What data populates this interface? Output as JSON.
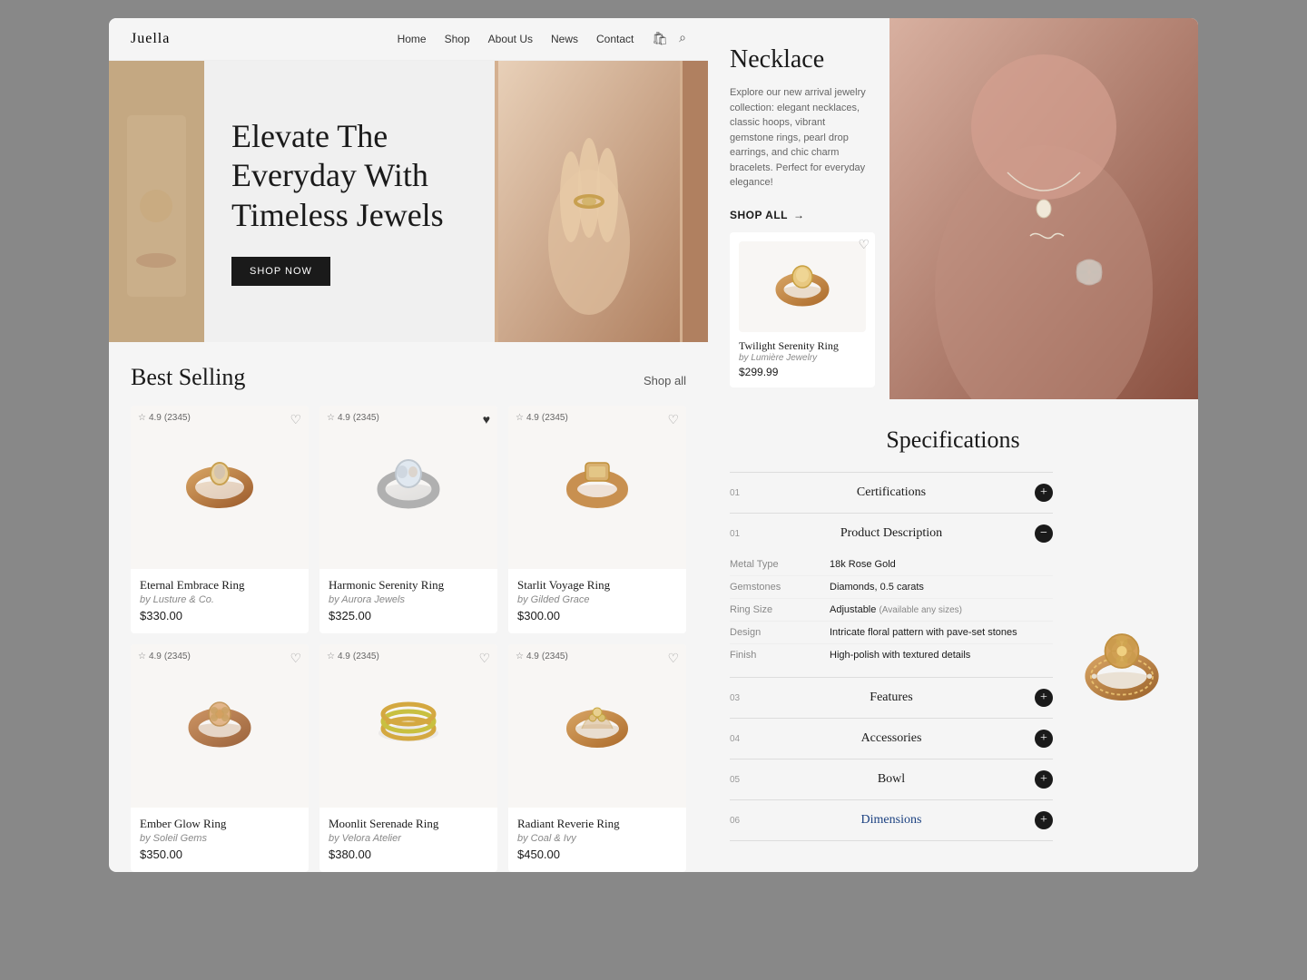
{
  "brand": "Juella",
  "nav": {
    "links": [
      "Home",
      "Shop",
      "About Us",
      "News",
      "Contact"
    ]
  },
  "hero": {
    "title": "Elevate The Everyday With Timeless Jewels",
    "cta": "SHOP NOW"
  },
  "best_selling": {
    "title": "Best Selling",
    "shop_all": "Shop all",
    "products": [
      {
        "name": "Eternal Embrace Ring",
        "brand": "by Lusture & Co.",
        "price": "$330.00",
        "rating": "4.9",
        "review_count": "(2345)",
        "favorited": false,
        "row": 1
      },
      {
        "name": "Harmonic Serenity Ring",
        "brand": "by Aurora Jewels",
        "price": "$325.00",
        "rating": "4.9",
        "review_count": "(2345)",
        "favorited": true,
        "row": 1
      },
      {
        "name": "Starlit Voyage Ring",
        "brand": "by Gilded Grace",
        "price": "$300.00",
        "rating": "4.9",
        "review_count": "(2345)",
        "favorited": false,
        "row": 1
      },
      {
        "name": "Ember Glow Ring",
        "brand": "by Soleil Gems",
        "price": "$350.00",
        "rating": "4.9",
        "review_count": "(2345)",
        "favorited": false,
        "row": 2
      },
      {
        "name": "Moonlit Serenade Ring",
        "brand": "by Velora Atelier",
        "price": "$380.00",
        "rating": "4.9",
        "review_count": "(2345)",
        "favorited": false,
        "row": 2
      },
      {
        "name": "Radiant Reverie Ring",
        "brand": "by Coal & Ivy",
        "price": "$450.00",
        "rating": "4.9",
        "review_count": "(2345)",
        "favorited": false,
        "row": 2
      }
    ]
  },
  "necklace": {
    "title": "Necklace",
    "description": "Explore our new arrival jewelry collection: elegant necklaces, classic hoops, vibrant gemstone rings, pearl drop earrings, and chic charm bracelets. Perfect for everyday elegance!",
    "shop_all": "SHOP ALL",
    "featured_product": {
      "name": "Twilight Serenity Ring",
      "brand": "by Lumière Jewelry",
      "price": "$299.99"
    }
  },
  "specifications": {
    "title": "Specifications",
    "sections": [
      {
        "num": "01",
        "label": "Certifications",
        "expanded": false
      },
      {
        "num": "01",
        "label": "Product Description",
        "expanded": true,
        "rows": [
          {
            "key": "Metal Type",
            "value": "18k Rose Gold"
          },
          {
            "key": "Gemstones",
            "value": "Diamonds, 0.5 carats"
          },
          {
            "key": "Ring Size",
            "value": "Adjustable",
            "note": "(Available any sizes)"
          },
          {
            "key": "Design",
            "value": "Intricate floral pattern with pave-set stones"
          },
          {
            "key": "Finish",
            "value": "High-polish with textured details"
          }
        ]
      },
      {
        "num": "03",
        "label": "Features",
        "expanded": false
      },
      {
        "num": "04",
        "label": "Accessories",
        "expanded": false
      },
      {
        "num": "05",
        "label": "Bowl",
        "expanded": false
      },
      {
        "num": "06",
        "label": "Dimensions",
        "expanded": false,
        "highlight": true
      }
    ]
  }
}
